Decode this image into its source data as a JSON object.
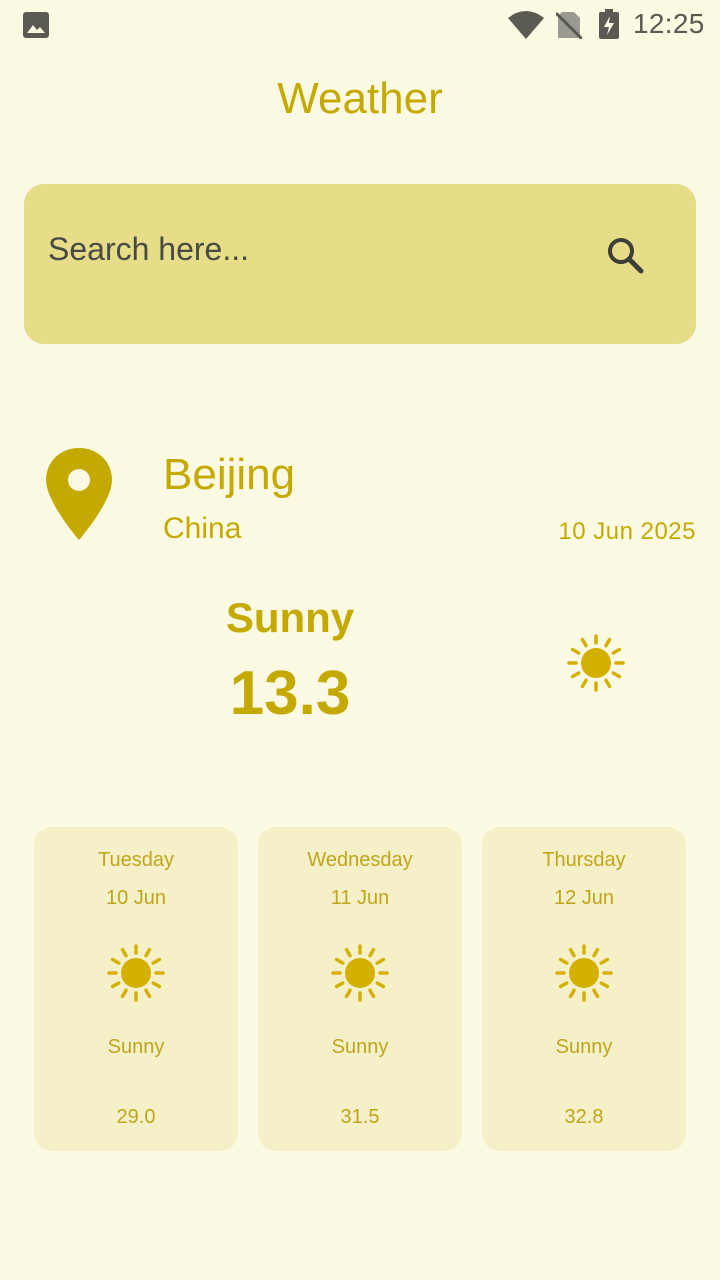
{
  "status_bar": {
    "time": "12:25",
    "icons": [
      "image-icon",
      "wifi-icon",
      "no-sim-icon",
      "battery-charging-icon"
    ],
    "icon_color": "#5A5A52"
  },
  "header": {
    "title": "Weather"
  },
  "search": {
    "placeholder": "Search here...",
    "value": "",
    "icon": "search-icon"
  },
  "location": {
    "icon": "location-pin-icon",
    "city": "Beijing",
    "country": "China",
    "date": "10 Jun 2025"
  },
  "current": {
    "condition": "Sunny",
    "temperature": "13.3",
    "icon": "sun-icon"
  },
  "forecast": [
    {
      "day": "Tuesday",
      "date": "10 Jun",
      "condition": "Sunny",
      "temperature": "29.0",
      "icon": "sun-icon"
    },
    {
      "day": "Wednesday",
      "date": "11 Jun",
      "condition": "Sunny",
      "temperature": "31.5",
      "icon": "sun-icon"
    },
    {
      "day": "Thursday",
      "date": "12 Jun",
      "condition": "Sunny",
      "temperature": "32.8",
      "icon": "sun-icon"
    }
  ],
  "colors": {
    "background": "#FDFAE3",
    "accent": "#C4AA00",
    "search_bg": "#E7DC87",
    "card_bg": "#F6F0C8"
  }
}
